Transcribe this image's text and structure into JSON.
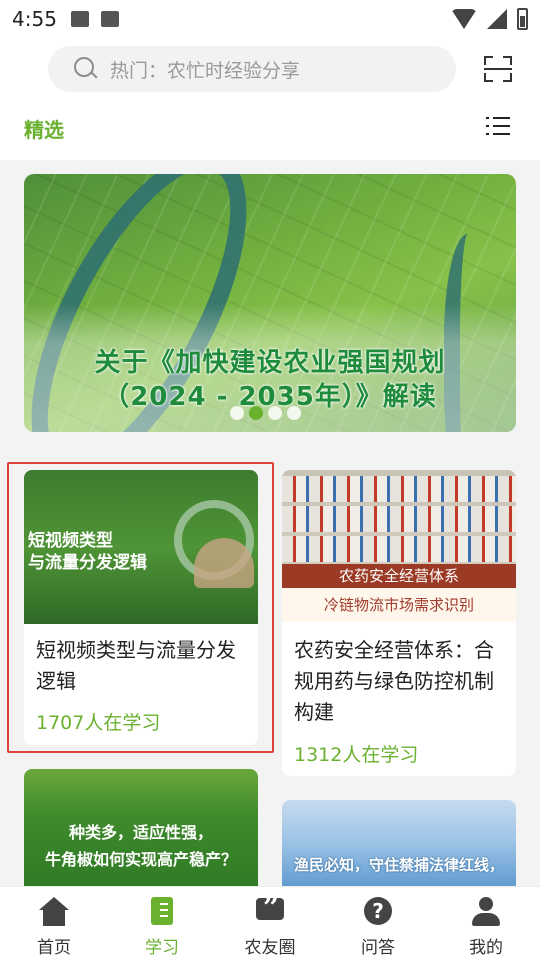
{
  "status_bar": {
    "time": "4:55"
  },
  "header": {
    "search_placeholder": "热门：农忙时经验分享",
    "section_title": "精选"
  },
  "banner": {
    "title_line1": "关于《加快建设农业强国规划",
    "title_line2": "（2024 - 2035年）》解读",
    "slide_count": 4,
    "active_slide": 2
  },
  "courses": [
    {
      "thumb_text_line1": "短视频类型",
      "thumb_text_line2": "与流量分发逻辑",
      "title": "短视频类型与流量分发逻辑",
      "learners": "1707人在学习"
    },
    {
      "thumb_text_line1": "农药安全经营体系",
      "thumb_text_line2": "冷链物流市场需求识别",
      "title": "农药安全经营体系：合规用药与绿色防控机制构建",
      "learners": "1312人在学习"
    },
    {
      "thumb_text_line1": "种类多，适应性强，",
      "thumb_text_line2": "牛角椒如何实现高产稳产？"
    },
    {
      "thumb_text_line1": "渔民必知，守住禁捕法律红线，"
    }
  ],
  "tabbar": {
    "items": [
      {
        "label": "首页",
        "icon": "home-icon"
      },
      {
        "label": "学习",
        "icon": "book-icon",
        "active": true
      },
      {
        "label": "农友圈",
        "icon": "chat-icon"
      },
      {
        "label": "问答",
        "icon": "question-icon"
      },
      {
        "label": "我的",
        "icon": "profile-icon"
      }
    ]
  },
  "colors": {
    "accent": "#6bb130",
    "highlight": "#e0403a"
  }
}
